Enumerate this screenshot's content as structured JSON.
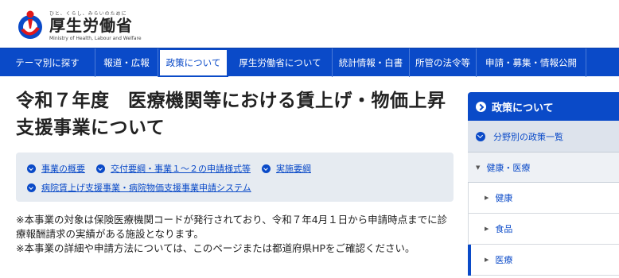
{
  "header": {
    "tagline": "ひと、くらし、みらいのために",
    "name": "厚生労働省",
    "name_en": "Ministry of Health, Labour and Welfare"
  },
  "gnav": [
    {
      "label": "テーマ別に探す",
      "w": 120,
      "active": false
    },
    {
      "label": "報道・広報",
      "w": 79,
      "active": false
    },
    {
      "label": "政策について",
      "w": 88,
      "active": true
    },
    {
      "label": "厚生労働省について",
      "w": 131,
      "active": false
    },
    {
      "label": "統計情報・白書",
      "w": 97,
      "active": false
    },
    {
      "label": "所管の法令等",
      "w": 84,
      "active": false
    },
    {
      "label": "申請・募集・情報公開",
      "w": 138,
      "active": false
    }
  ],
  "main": {
    "title": "令和７年度　医療機関等における賃上げ・物価上昇支援事業について",
    "local_nav": [
      [
        "事業の概要",
        "交付要綱・事業１～２の申請様式等",
        "実施要綱"
      ],
      [
        "病院賃上げ支援事業・病院物価支援事業申請システム"
      ]
    ],
    "notes": [
      "※本事業の対象は保険医療機関コードが発行されており、令和７年4月１日から申請時点までに診療報酬請求の実績がある施設となります。",
      "※本事業の詳細や申請方法については、このページまたは都道府県HPをご確認ください。"
    ]
  },
  "side": {
    "head": "政策について",
    "category": "分野別の政策一覧",
    "sub": "健康・医療",
    "items": [
      {
        "label": "健康",
        "current": false
      },
      {
        "label": "食品",
        "current": false
      },
      {
        "label": "医療",
        "current": true
      }
    ]
  },
  "colors": {
    "brand": "#0a4ac8",
    "local_nav_bg": "#e6ebf1"
  }
}
